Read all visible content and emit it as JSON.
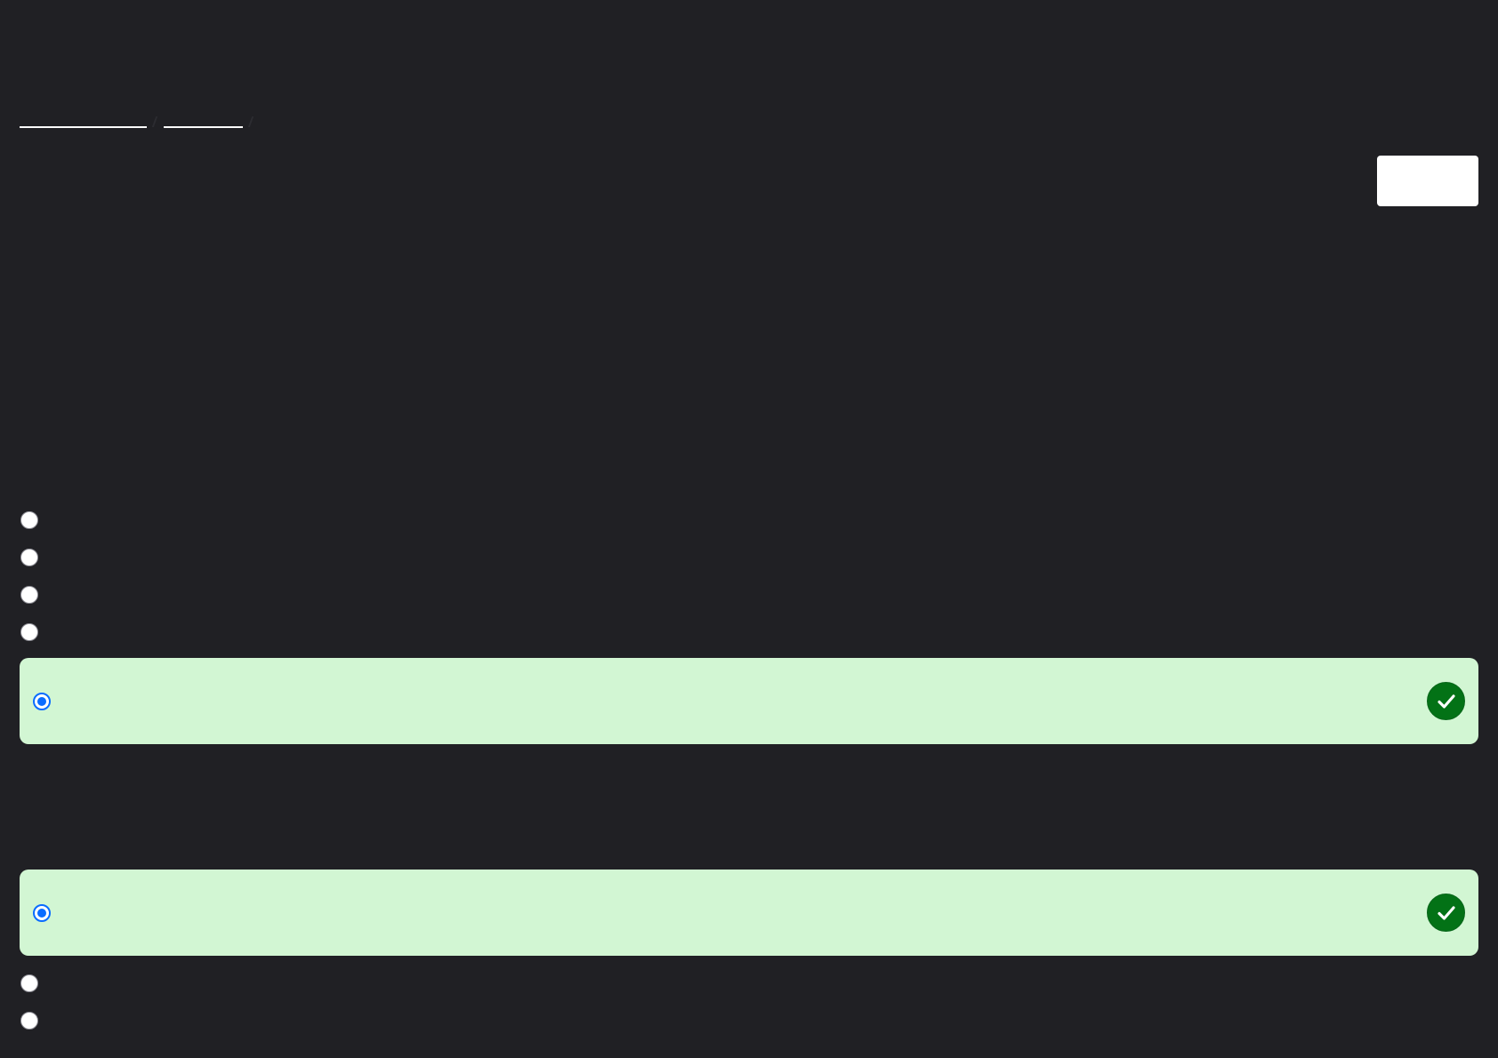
{
  "breadcrumb": {
    "items": [
      {
        "label": ""
      },
      {
        "label": ""
      }
    ],
    "separator": "/"
  },
  "toolbar": {
    "action_label": ""
  },
  "question_1": {
    "options": [
      {
        "label": "",
        "selected": false,
        "correct": false
      },
      {
        "label": "",
        "selected": false,
        "correct": false
      },
      {
        "label": "",
        "selected": false,
        "correct": false
      },
      {
        "label": "",
        "selected": false,
        "correct": false
      },
      {
        "label": "",
        "selected": true,
        "correct": true
      }
    ]
  },
  "question_2": {
    "options": [
      {
        "label": "",
        "selected": true,
        "correct": true
      },
      {
        "label": "",
        "selected": false,
        "correct": false
      },
      {
        "label": "",
        "selected": false,
        "correct": false
      }
    ]
  },
  "colors": {
    "background": "#202024",
    "correct_fill": "#d2f6d3",
    "correct_badge": "#037216",
    "radio_selected": "#0a6cff"
  },
  "icons": {
    "correct": "check-circle-icon"
  }
}
